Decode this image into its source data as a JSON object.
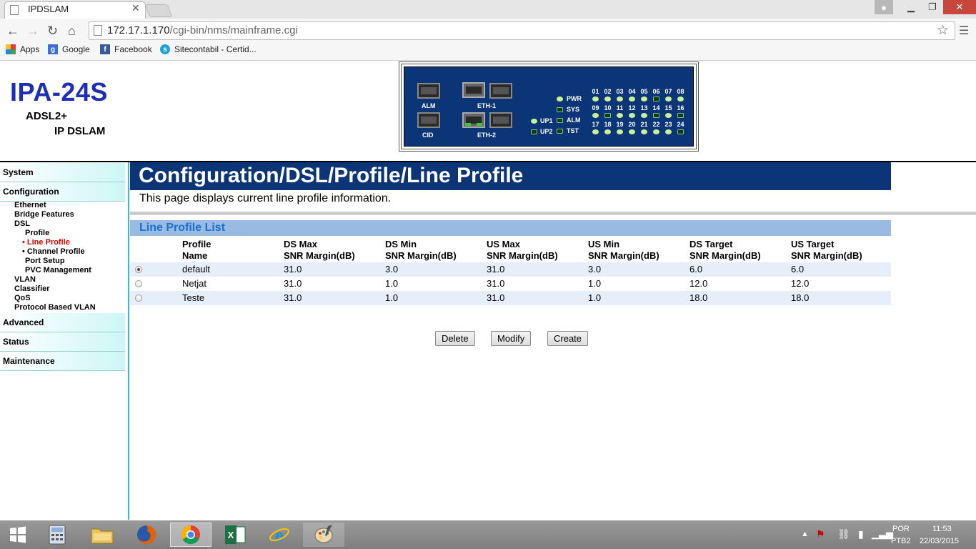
{
  "browser": {
    "tab_title": "IPDSLAM",
    "url_host": "172.17.1.170",
    "url_path": "/cgi-bin/nms/mainframe.cgi",
    "bookmarks": [
      {
        "label": "Apps",
        "icon": "apps-grid-icon"
      },
      {
        "label": "Google",
        "icon": "google-icon"
      },
      {
        "label": "Facebook",
        "icon": "facebook-icon"
      },
      {
        "label": "Sitecontabil - Certid...",
        "icon": "sitecontabil-icon"
      }
    ]
  },
  "header": {
    "model": "IPA-24S",
    "sub1": "ADSL2+",
    "sub2": "IP DSLAM",
    "device": {
      "port_labels": {
        "alm": "ALM",
        "cid": "CID",
        "eth1": "ETH-1",
        "eth2": "ETH-2"
      },
      "status_labels": [
        "PWR",
        "SYS",
        "ALM",
        "TST"
      ],
      "status_on": [
        true,
        false,
        false,
        false
      ],
      "uplink_labels": [
        "UP1",
        "UP2"
      ],
      "uplink_on": [
        true,
        false
      ],
      "line_numbers": [
        "01",
        "02",
        "03",
        "04",
        "05",
        "06",
        "07",
        "08",
        "09",
        "10",
        "11",
        "12",
        "13",
        "14",
        "15",
        "16",
        "17",
        "18",
        "19",
        "20",
        "21",
        "22",
        "23",
        "24"
      ],
      "line_on": [
        true,
        true,
        true,
        true,
        true,
        false,
        true,
        true,
        true,
        false,
        true,
        true,
        true,
        false,
        true,
        false,
        true,
        true,
        true,
        true,
        true,
        true,
        true,
        false
      ]
    }
  },
  "nav": {
    "sections": [
      "System",
      "Configuration",
      "Advanced",
      "Status",
      "Maintenance"
    ],
    "config_items": [
      {
        "label": "Ethernet",
        "level": 1
      },
      {
        "label": "Bridge Features",
        "level": 1
      },
      {
        "label": "DSL",
        "level": 1
      },
      {
        "label": "Profile",
        "level": 2
      },
      {
        "label": "• Line Profile",
        "level": 3,
        "active": true
      },
      {
        "label": "• Channel Profile",
        "level": 3
      },
      {
        "label": "Port Setup",
        "level": 2
      },
      {
        "label": "PVC Management",
        "level": 2
      },
      {
        "label": "VLAN",
        "level": 1
      },
      {
        "label": "Classifier",
        "level": 1
      },
      {
        "label": "QoS",
        "level": 1
      },
      {
        "label": "Protocol Based VLAN",
        "level": 1
      }
    ]
  },
  "main": {
    "title": "Configuration/DSL/Profile/Line Profile",
    "description": "This page displays current line profile information.",
    "section_title": "Line Profile List",
    "columns": [
      [
        "Profile",
        "Name"
      ],
      [
        "DS Max",
        "SNR Margin(dB)"
      ],
      [
        "DS Min",
        "SNR Margin(dB)"
      ],
      [
        "US Max",
        "SNR Margin(dB)"
      ],
      [
        "US Min",
        "SNR Margin(dB)"
      ],
      [
        "DS Target",
        "SNR Margin(dB)"
      ],
      [
        "US Target",
        "SNR Margin(dB)"
      ]
    ],
    "rows": [
      {
        "selected": true,
        "cells": [
          "default",
          "31.0",
          "3.0",
          "31.0",
          "3.0",
          "6.0",
          "6.0"
        ]
      },
      {
        "selected": false,
        "cells": [
          "Netjat",
          "31.0",
          "1.0",
          "31.0",
          "1.0",
          "12.0",
          "12.0"
        ]
      },
      {
        "selected": false,
        "cells": [
          "Teste",
          "31.0",
          "1.0",
          "31.0",
          "1.0",
          "18.0",
          "18.0"
        ]
      }
    ],
    "buttons": {
      "delete": "Delete",
      "modify": "Modify",
      "create": "Create"
    }
  },
  "taskbar": {
    "apps": [
      "windows-start-icon",
      "calculator-icon",
      "file-explorer-icon",
      "firefox-icon",
      "chrome-icon",
      "excel-icon",
      "internet-explorer-icon",
      "paint-icon"
    ],
    "lang1": "POR",
    "lang2": "PTB2",
    "time": "11:53",
    "date": "22/03/2015"
  }
}
